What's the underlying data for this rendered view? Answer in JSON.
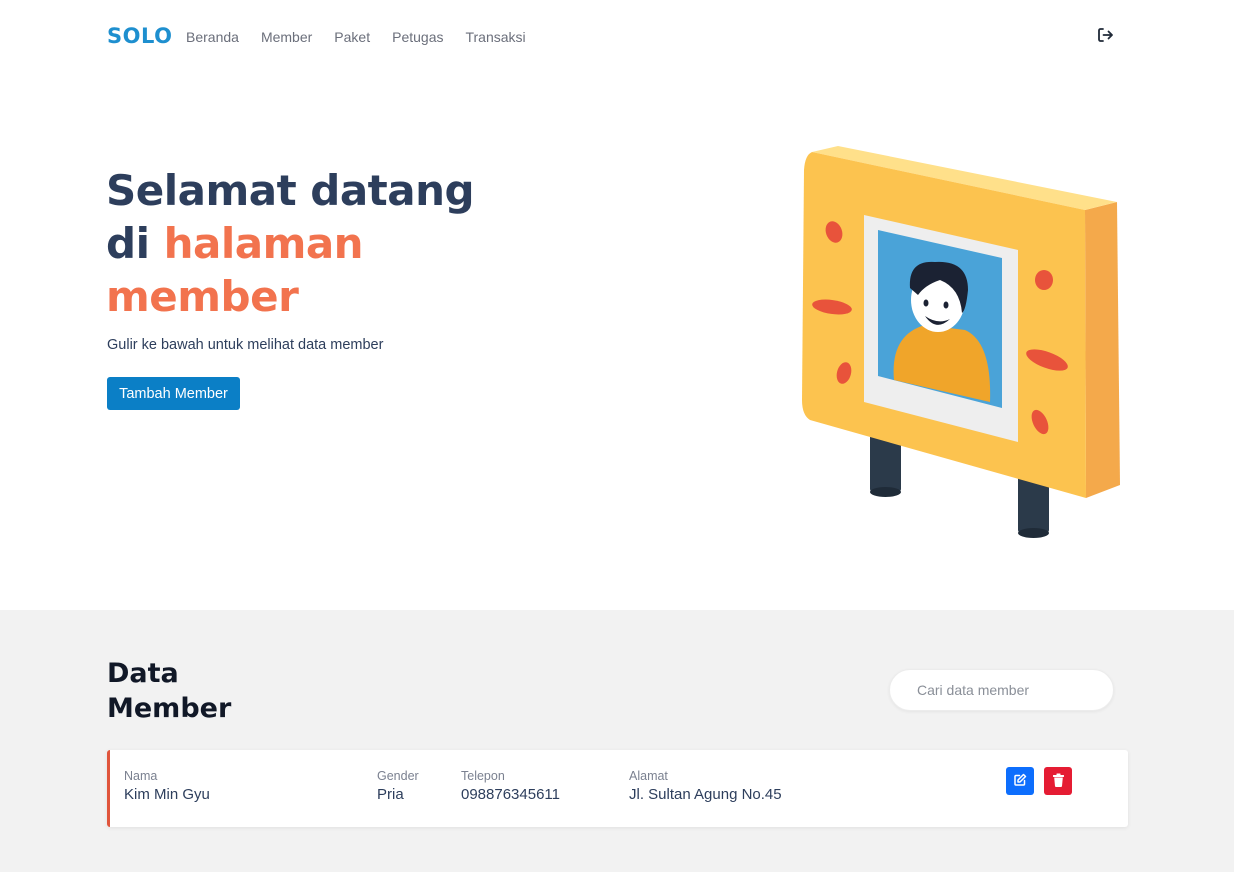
{
  "navbar": {
    "brand": "SOLO",
    "links": [
      "Beranda",
      "Member",
      "Paket",
      "Petugas",
      "Transaksi"
    ],
    "logout_icon": "logout-icon"
  },
  "hero": {
    "title_line1": "Selamat datang",
    "title_line2_prefix": "di ",
    "title_line2_accent": "halaman",
    "title_line3_accent": "member",
    "subtitle": "Gulir ke bawah untuk melihat data member",
    "add_button": "Tambah Member",
    "illustration_icon": "member-billboard-illustration"
  },
  "data_section": {
    "title_line1": "Data",
    "title_line2": "Member",
    "search_placeholder": "Cari data member",
    "members": [
      {
        "nama_label": "Nama",
        "nama": "Kim Min Gyu",
        "gender_label": "Gender",
        "gender": "Pria",
        "telepon_label": "Telepon",
        "telepon": "098876345611",
        "alamat_label": "Alamat",
        "alamat": "Jl. Sultan Agung No.45",
        "edit_icon": "edit-icon",
        "delete_icon": "trash-icon"
      }
    ]
  },
  "colors": {
    "brand": "#1e8fcf",
    "heading": "#2d3e5c",
    "accent": "#f2734e",
    "primary_button": "#0b7fc6",
    "edit_button": "#0d6efd",
    "delete_button": "#e51c33",
    "section_bg": "#f2f2f2"
  }
}
